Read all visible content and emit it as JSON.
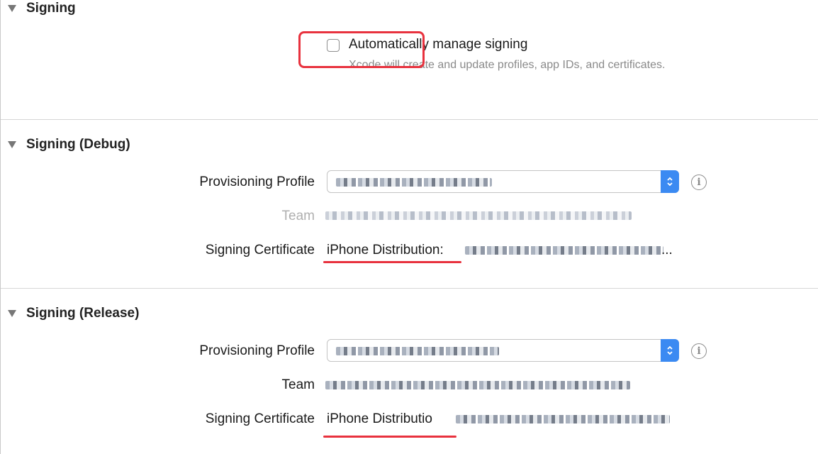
{
  "signing": {
    "title": "Signing",
    "auto_manage_label": "Automatically manage signing",
    "auto_manage_checked": false,
    "auto_manage_description": "Xcode will create and update profiles, app IDs, and certificates."
  },
  "debug": {
    "title": "Signing (Debug)",
    "profile_label": "Provisioning Profile",
    "team_label": "Team",
    "certificate_label": "Signing Certificate",
    "certificate_value": "iPhone Distribution:",
    "certificate_ellipsis": "..."
  },
  "release": {
    "title": "Signing (Release)",
    "profile_label": "Provisioning Profile",
    "team_label": "Team",
    "certificate_label": "Signing Certificate",
    "certificate_value": "iPhone Distributio"
  },
  "colors": {
    "annotation_red": "#e8323e",
    "popup_accent": "#3b8af2"
  },
  "icons": {
    "disclosure": "disclosure-triangle-down",
    "popup": "up-down-chevron",
    "info": "info-circle"
  }
}
